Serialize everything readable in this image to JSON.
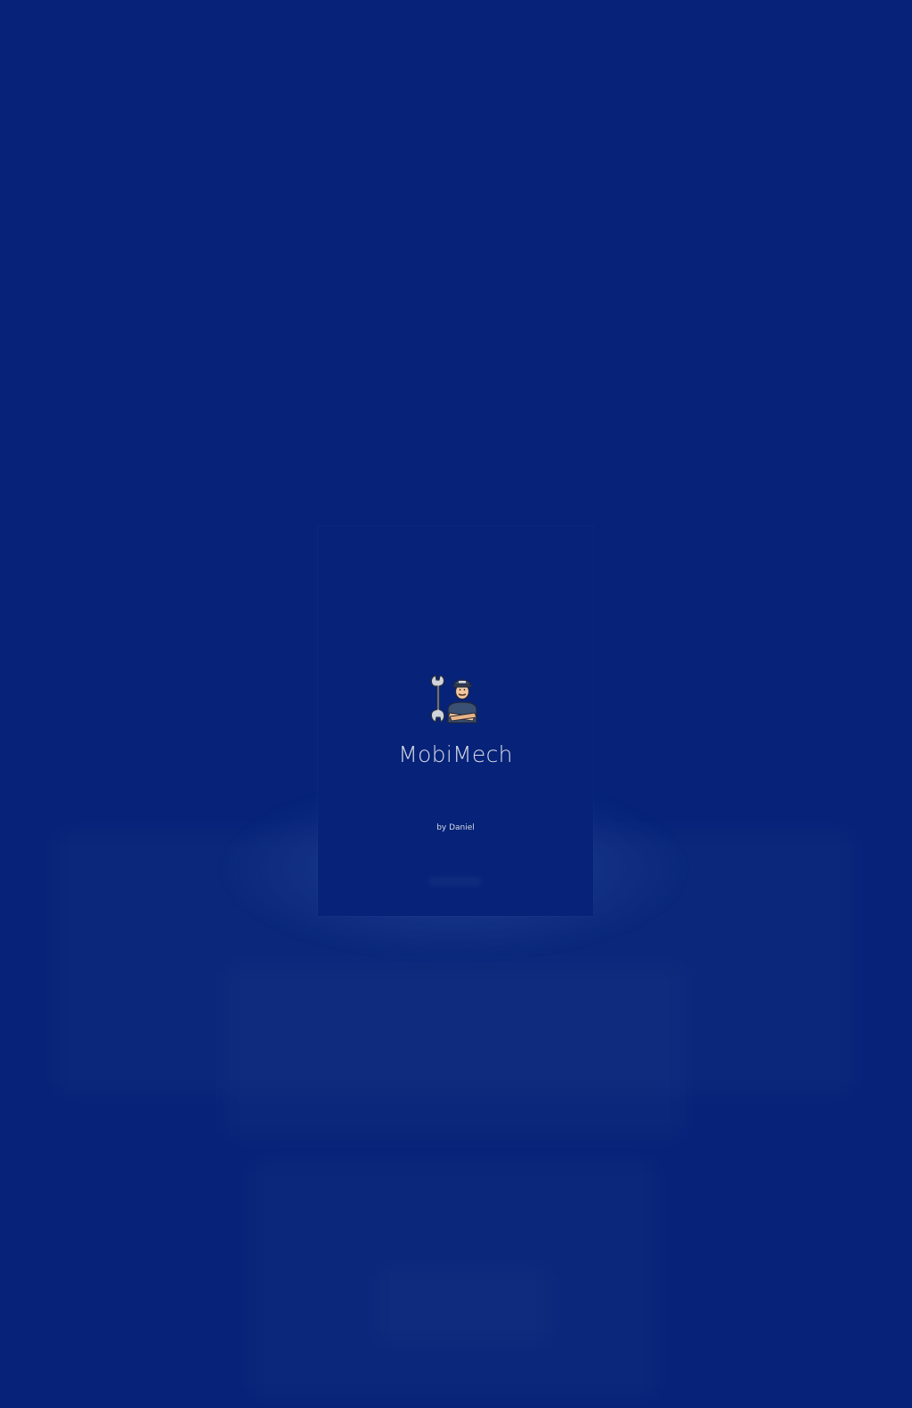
{
  "app": {
    "name": "MobiMech",
    "byline": "by Daniel",
    "logo_icon": "mechanic-with-wrench-icon"
  },
  "colors": {
    "background": "#062379",
    "title_text": "#d9dbe6"
  }
}
